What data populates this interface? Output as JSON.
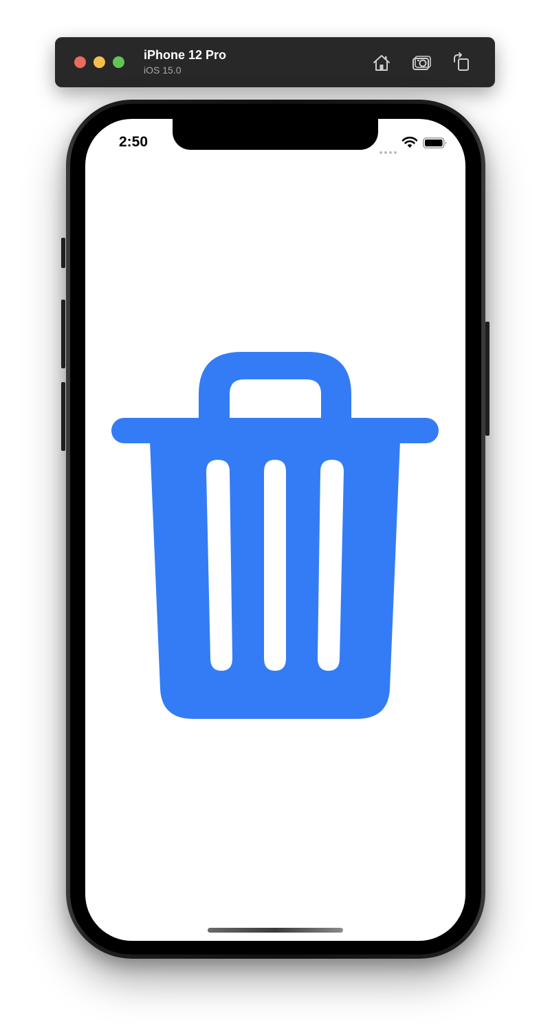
{
  "simulator": {
    "device_name": "iPhone 12 Pro",
    "os_version": "iOS 15.0",
    "window_controls": [
      "close",
      "minimize",
      "zoom"
    ],
    "toolbar_icons": [
      "home-icon",
      "screenshot-icon",
      "rotate-icon"
    ]
  },
  "status_bar": {
    "time": "2:50",
    "icons": [
      "cellular-signal-icon",
      "wifi-icon",
      "battery-icon"
    ]
  },
  "content": {
    "icon": "trash-icon",
    "icon_color": "#347cf5"
  },
  "colors": {
    "titlebar": "#282828",
    "close": "#ed6a5e",
    "minimize": "#f5bf4f",
    "zoom": "#61c554",
    "screen_background": "#ffffff"
  }
}
